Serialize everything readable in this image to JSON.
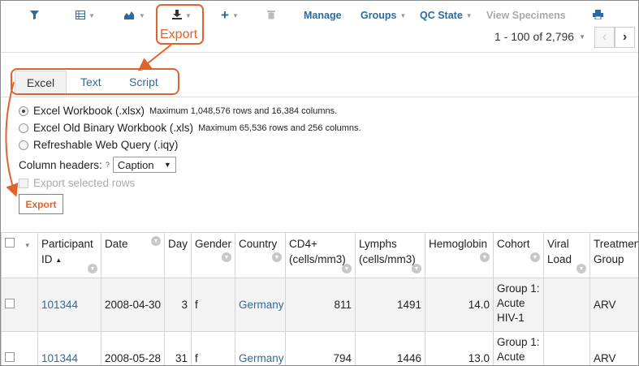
{
  "toolbar": {
    "icons": [
      {
        "name": "filter-icon",
        "glyph": "▼"
      },
      {
        "name": "grid-view-icon",
        "glyph": "▦"
      },
      {
        "name": "chart-icon",
        "glyph": "◣"
      },
      {
        "name": "export-icon",
        "glyph": "⤓"
      },
      {
        "name": "insert-icon",
        "glyph": "+"
      },
      {
        "name": "delete-icon",
        "glyph": "🗑"
      },
      {
        "name": "print-icon",
        "glyph": "⎙"
      }
    ],
    "manage_label": "Manage",
    "groups_label": "Groups",
    "qc_state_label": "QC State",
    "view_specimens_label": "View Specimens",
    "pager_text": "1 - 100 of 2,796",
    "prev_glyph": "‹",
    "next_glyph": "›"
  },
  "callout": {
    "export_label": "Export",
    "accent_color": "#e0632e"
  },
  "tabs": [
    {
      "label": "Excel",
      "active": true
    },
    {
      "label": "Text",
      "active": false
    },
    {
      "label": "Script",
      "active": false
    }
  ],
  "export_options": {
    "options": [
      {
        "label": "Excel Workbook (.xlsx)",
        "note": "Maximum 1,048,576 rows and 16,384 columns.",
        "selected": true
      },
      {
        "label": "Excel Old Binary Workbook (.xls)",
        "note": "Maximum 65,536 rows and 256 columns.",
        "selected": false
      },
      {
        "label": "Refreshable Web Query (.iqy)",
        "note": "",
        "selected": false
      }
    ],
    "column_headers_label": "Column headers:",
    "help_mark": "?",
    "column_headers_value": "Caption",
    "export_selected_rows_label": "Export selected rows",
    "export_button_label": "Export"
  },
  "table": {
    "headers": [
      {
        "l1": "Participant",
        "l2": "ID"
      },
      {
        "l1": "Date",
        "l2": ""
      },
      {
        "l1": "Day",
        "l2": ""
      },
      {
        "l1": "Gender",
        "l2": ""
      },
      {
        "l1": "Country",
        "l2": ""
      },
      {
        "l1": "CD4+",
        "l2": "(cells/mm3)"
      },
      {
        "l1": "Lymphs",
        "l2": "(cells/mm3)"
      },
      {
        "l1": "Hemoglobin",
        "l2": ""
      },
      {
        "l1": "Cohort",
        "l2": ""
      },
      {
        "l1": "Viral",
        "l2": "Load"
      },
      {
        "l1": "Treatment",
        "l2": "Group"
      }
    ],
    "rows": [
      {
        "participant_id": "101344",
        "date": "2008-04-30",
        "day": "3",
        "gender": "f",
        "country": "Germany",
        "cd4": "811",
        "lymphs": "1491",
        "hemoglobin": "14.0",
        "cohort": "Group 1: Acute HIV-1",
        "viral_load": "",
        "treatment": "ARV"
      },
      {
        "participant_id": "101344",
        "date": "2008-05-28",
        "day": "31",
        "gender": "f",
        "country": "Germany",
        "cd4": "794",
        "lymphs": "1446",
        "hemoglobin": "13.0",
        "cohort": "Group 1: Acute",
        "viral_load": "",
        "treatment": "ARV"
      }
    ]
  }
}
